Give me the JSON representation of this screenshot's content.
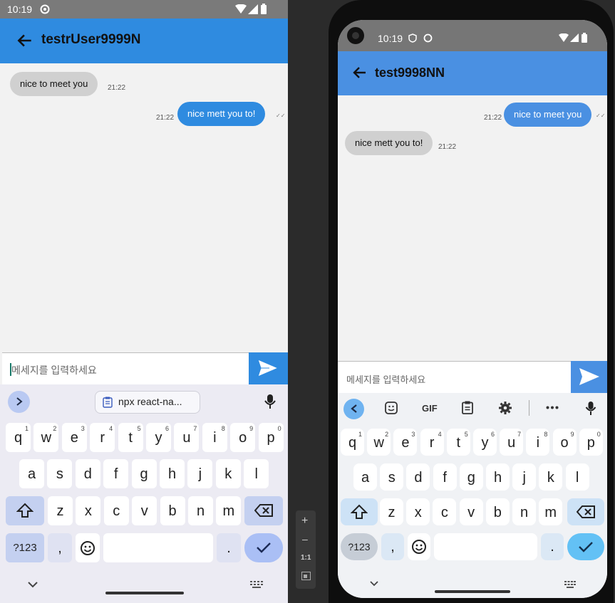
{
  "left": {
    "status_time": "10:19",
    "chat_title": "testrUser9999N",
    "messages": [
      {
        "side": "left",
        "text": "nice to meet you",
        "time": "21:22"
      },
      {
        "side": "right",
        "text": "nice mett you to!",
        "time": "21:22"
      }
    ],
    "input_placeholder": "메세지를 입력하세요",
    "clipboard_suggestion": "npx react-na...",
    "keyboard": {
      "row1": [
        "q",
        "w",
        "e",
        "r",
        "t",
        "y",
        "u",
        "i",
        "o",
        "p"
      ],
      "row1_nums": [
        "1",
        "2",
        "3",
        "4",
        "5",
        "6",
        "7",
        "8",
        "9",
        "0"
      ],
      "row2": [
        "a",
        "s",
        "d",
        "f",
        "g",
        "h",
        "j",
        "k",
        "l"
      ],
      "row3": [
        "z",
        "x",
        "c",
        "v",
        "b",
        "n",
        "m"
      ],
      "sym_key": "?123",
      "comma_key": ",",
      "period_key": "."
    }
  },
  "emulator_toolbar": {
    "zoom_in": "+",
    "zoom_out": "–",
    "actual_size": "1:1"
  },
  "right": {
    "status_time": "10:19",
    "chat_title": "test9998NN",
    "messages": [
      {
        "side": "right",
        "text": "nice to meet you",
        "time": "21:22"
      },
      {
        "side": "left",
        "text": "nice mett you to!",
        "time": "21:22"
      }
    ],
    "input_placeholder": "메세지를 입력하세요",
    "toolbar_gif": "GIF",
    "keyboard": {
      "row1": [
        "q",
        "w",
        "e",
        "r",
        "t",
        "y",
        "u",
        "i",
        "o",
        "p"
      ],
      "row1_nums": [
        "1",
        "2",
        "3",
        "4",
        "5",
        "6",
        "7",
        "8",
        "9",
        "0"
      ],
      "row2": [
        "a",
        "s",
        "d",
        "f",
        "g",
        "h",
        "j",
        "k",
        "l"
      ],
      "row3": [
        "z",
        "x",
        "c",
        "v",
        "b",
        "n",
        "m"
      ],
      "sym_key": "?123",
      "comma_key": ",",
      "period_key": "."
    }
  },
  "colors": {
    "header_blue": "#2f8be0",
    "bubble_gray": "#d0d0d0",
    "keyboard_bg_left": "#ecebf3",
    "keyboard_bg_right": "#f0f2f5"
  }
}
